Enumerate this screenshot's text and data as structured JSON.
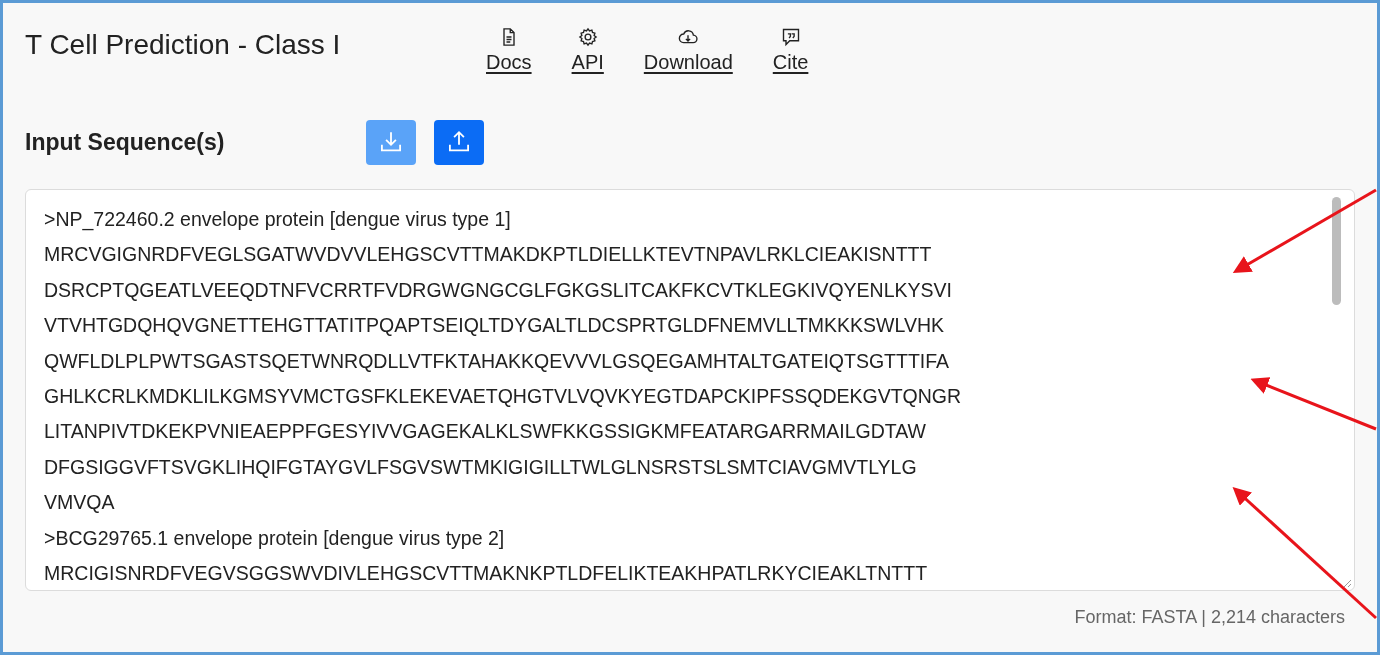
{
  "page": {
    "title": "T Cell Prediction - Class I"
  },
  "nav_links": [
    {
      "label": "Docs",
      "kind": "document"
    },
    {
      "label": "API",
      "kind": "gear"
    },
    {
      "label": "Download",
      "kind": "cloud"
    },
    {
      "label": "Cite",
      "kind": "quote"
    }
  ],
  "input_section": {
    "label": "Input Sequence(s)",
    "buttons": [
      {
        "kind": "download",
        "disabled": true
      },
      {
        "kind": "upload",
        "disabled": false
      }
    ],
    "sequence_field": {
      "lines": [
        ">NP_722460.2 envelope protein [dengue virus type 1]",
        "MRCVGIGNRDFVEGLSGATWVDVVLEHGSCVTTMAKDKPTLDIELLKTEVTNPAVLRKLCIEAKISNTTT",
        "DSRCPTQGEATLVEEQDTNFVCRRTFVDRGWGNGCGLFGKGSLITCAKFKCVTKLEGKIVQYENLKYSVI",
        "VTVHTGDQHQVGNETTEHGTTATITPQAPTSEIQLTDYGALTLDCSPRTGLDFNEMVLLTMKKKSWLVHK",
        "QWFLDLPLPWTSGASTSQETWNRQDLLVTFKTAHAKKQEVVVLGSQEGAMHTALTGATEIQTSGTTTIFA",
        "GHLKCRLKMDKLILKGMSYVMCTGSFKLEKEVAETQHGTVLVQVKYEGTDAPCKIPFSSQDEKGVTQNGR",
        "LITANPIVTDKEKPVNIEAEPPFGESYIVVGAGEKALKLSWFKKGSSIGKMFEATARGARRMAILGDTAW",
        "DFGSIGGVFTSVGKLIHQIFGTAYGVLFSGVSWTMKIGIGILLTWLGLNSRSTSLSMTCIAVGMVTLYLG",
        "VMVQA",
        ">BCG29765.1 envelope protein [dengue virus type 2]",
        "MRCIGISNRDFVEGVSGGSWVDIVLEHGSCVTTMAKNKPTLDFELIKTEAKHPATLRKYCIEAKLTNTTT"
      ]
    }
  },
  "footer": "Format: FASTA | 2,214 characters"
}
